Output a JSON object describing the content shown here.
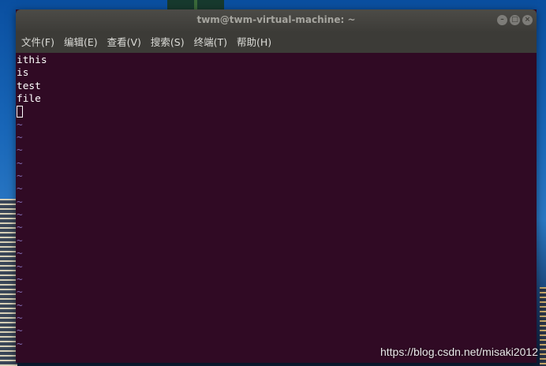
{
  "window": {
    "title": "twm@twm-virtual-machine: ~"
  },
  "menu": {
    "items": [
      "文件(F)",
      "编辑(E)",
      "查看(V)",
      "搜索(S)",
      "终端(T)",
      "帮助(H)"
    ]
  },
  "terminal": {
    "lines": [
      "ithis",
      "is",
      "test",
      "file"
    ],
    "empty_line_marker": "~",
    "empty_line_count": 18
  },
  "watermark": "https://blog.csdn.net/misaki2012",
  "colors": {
    "terminal_bg": "#300a24",
    "titlebar_bg": "#3d3c38",
    "tilde": "#7f6bb0"
  },
  "icons": {
    "minimize": "minimize-icon",
    "maximize": "maximize-icon",
    "close": "close-icon"
  }
}
